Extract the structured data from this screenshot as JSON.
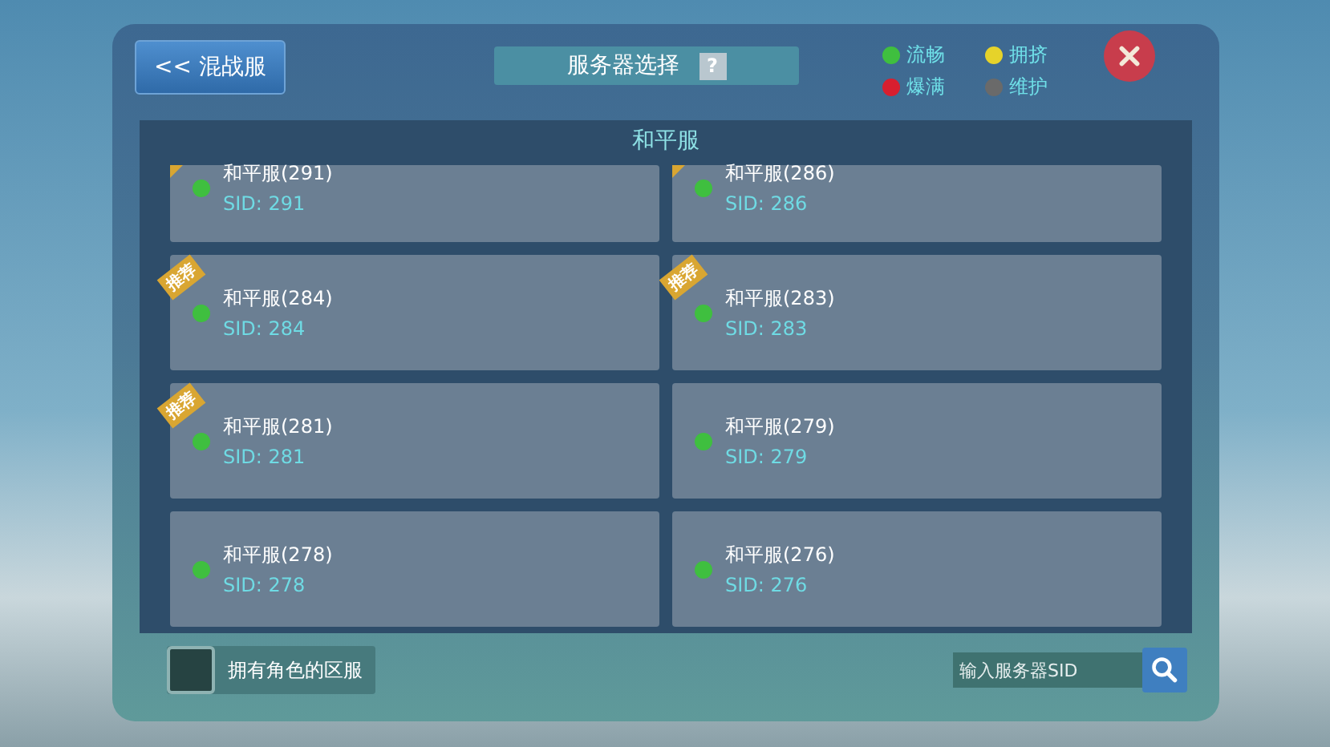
{
  "back_button": {
    "label": "<< 混战服"
  },
  "title": {
    "text": "服务器选择",
    "help": "?"
  },
  "legend": [
    {
      "label": "流畅",
      "color": "#3fbf3f"
    },
    {
      "label": "拥挤",
      "color": "#e6d32a"
    },
    {
      "label": "爆满",
      "color": "#d81f2f"
    },
    {
      "label": "维护",
      "color": "#6a6a6a"
    }
  ],
  "list": {
    "heading": "和平服",
    "servers": [
      {
        "name": "和平服(291)",
        "sid": "SID: 291",
        "color": "#3fbf3f",
        "recommended": true,
        "cut": true
      },
      {
        "name": "和平服(286)",
        "sid": "SID: 286",
        "color": "#3fbf3f",
        "recommended": true,
        "cut": true
      },
      {
        "name": "和平服(284)",
        "sid": "SID: 284",
        "color": "#3fbf3f",
        "recommended": true,
        "badge": "推荐"
      },
      {
        "name": "和平服(283)",
        "sid": "SID: 283",
        "color": "#3fbf3f",
        "recommended": true,
        "badge": "推荐"
      },
      {
        "name": "和平服(281)",
        "sid": "SID: 281",
        "color": "#3fbf3f",
        "recommended": true,
        "badge": "推荐"
      },
      {
        "name": "和平服(279)",
        "sid": "SID: 279",
        "color": "#3fbf3f",
        "recommended": false
      },
      {
        "name": "和平服(278)",
        "sid": "SID: 278",
        "color": "#3fbf3f",
        "recommended": false
      },
      {
        "name": "和平服(276)",
        "sid": "SID: 276",
        "color": "#3fbf3f",
        "recommended": false
      }
    ]
  },
  "own_filter": {
    "label": "拥有角色的区服",
    "checked": false
  },
  "sid_search": {
    "placeholder": "输入服务器SID"
  }
}
